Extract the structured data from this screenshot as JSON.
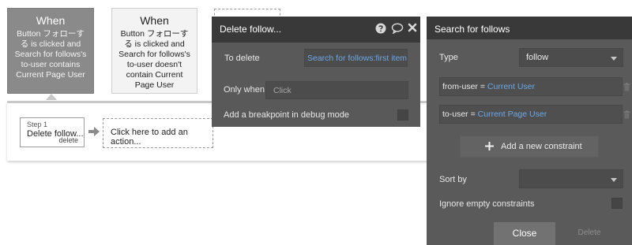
{
  "events": [
    {
      "title": "When",
      "description": "Button フォローする is clicked and Search for follows's to-user contains Current Page User"
    },
    {
      "title": "When",
      "description": "Button フォローする is clicked and Search for follows's to-user doesn't contain Current Page User"
    }
  ],
  "workflow": {
    "step": {
      "number_label": "Step 1",
      "action": "Delete follow...",
      "delete_label": "delete"
    },
    "add_action_label": "Click here to add an action..."
  },
  "delete_panel": {
    "title": "Delete follow...",
    "to_delete_label": "To delete",
    "to_delete_value": "Search for follows:first item",
    "only_when_label": "Only when",
    "only_when_placeholder": "Click",
    "breakpoint_label": "Add a breakpoint in debug mode"
  },
  "search_panel": {
    "title": "Search for follows",
    "type_label": "Type",
    "type_value": "follow",
    "constraints": [
      {
        "key": "from-user =",
        "value": "Current User"
      },
      {
        "key": "to-user =",
        "value": "Current Page User"
      }
    ],
    "add_constraint_label": "Add a new constraint",
    "sort_by_label": "Sort by",
    "sort_by_value": "",
    "ignore_empty_label": "Ignore empty constraints",
    "close_label": "Close",
    "delete_label": "Delete"
  },
  "colors": {
    "panel_header": "#393939",
    "panel_body": "#595959",
    "link_blue": "#6ca8e8",
    "selected_event": "#8a8a8a"
  }
}
